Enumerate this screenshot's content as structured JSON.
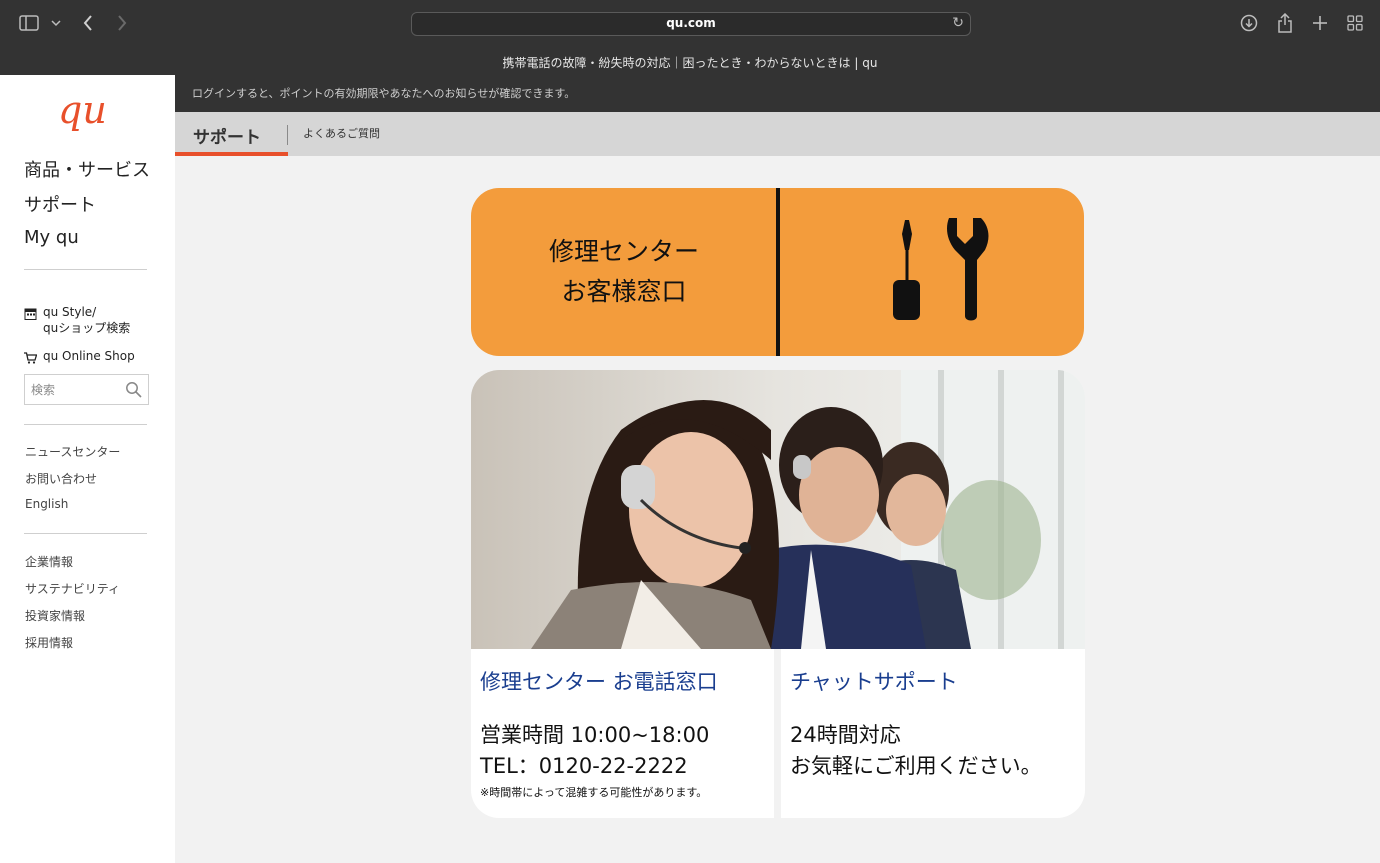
{
  "browser": {
    "url": "qu.com",
    "tab_title": "携帯電話の故障・紛失時の対応｜困ったとき・わからないときは | qu"
  },
  "sidebar": {
    "logo_text": "qu",
    "main_nav": [
      "商品・サービス",
      "サポート",
      "My qu"
    ],
    "shop_links": [
      {
        "icon": "store-icon",
        "label_line1": "qu Style/",
        "label_line2": "quショップ検索"
      },
      {
        "icon": "cart-icon",
        "label_line1": "qu Online Shop",
        "label_line2": ""
      }
    ],
    "search_placeholder": "検索",
    "links_group1": [
      "ニュースセンター",
      "お問い合わせ",
      "English"
    ],
    "links_group2": [
      "企業情報",
      "サステナビリティ",
      "投資家情報",
      "採用情報"
    ]
  },
  "info_bar": {
    "text": "ログインすると、ポイントの有効期限やあなたへのお知らせが確認できます。"
  },
  "tabs": {
    "active": "サポート",
    "other": "よくあるご質問"
  },
  "banner": {
    "line1": "修理センター",
    "line2": "お客様窓口",
    "icon": "tools-icon",
    "bg_color": "#f39c3c"
  },
  "phone_card": {
    "title": "修理センター お電話窓口",
    "hours": "営業時間 10:00~18:00",
    "tel": "TEL：0120-22-2222",
    "note": "※時間帯によって混雑する可能性があります。"
  },
  "chat_card": {
    "title": "チャットサポート",
    "line1": "24時間対応",
    "line2": "お気軽にご利用ください。"
  },
  "colors": {
    "accent": "#e8502b",
    "link_blue": "#1a3e8f",
    "chrome": "#333333"
  }
}
